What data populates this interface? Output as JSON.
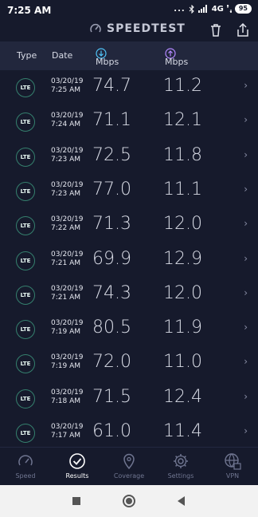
{
  "status": {
    "time": "7:25 AM",
    "dots": "...",
    "network": "4G",
    "battery": "95"
  },
  "app": {
    "title": "SPEEDTEST"
  },
  "header": {
    "type": "Type",
    "date": "Date",
    "download_unit": "Mbps",
    "upload_unit": "Mbps"
  },
  "results": [
    {
      "type": "LTE",
      "date": "03/20/19",
      "time": "7:25 AM",
      "download": "74.7",
      "upload": "11.2"
    },
    {
      "type": "LTE",
      "date": "03/20/19",
      "time": "7:24 AM",
      "download": "71.1",
      "upload": "12.1"
    },
    {
      "type": "LTE",
      "date": "03/20/19",
      "time": "7:23 AM",
      "download": "72.5",
      "upload": "11.8"
    },
    {
      "type": "LTE",
      "date": "03/20/19",
      "time": "7:23 AM",
      "download": "77.0",
      "upload": "11.1"
    },
    {
      "type": "LTE",
      "date": "03/20/19",
      "time": "7:22 AM",
      "download": "71.3",
      "upload": "12.0"
    },
    {
      "type": "LTE",
      "date": "03/20/19",
      "time": "7:21 AM",
      "download": "69.9",
      "upload": "12.9"
    },
    {
      "type": "LTE",
      "date": "03/20/19",
      "time": "7:21 AM",
      "download": "74.3",
      "upload": "12.0"
    },
    {
      "type": "LTE",
      "date": "03/20/19",
      "time": "7:19 AM",
      "download": "80.5",
      "upload": "11.9"
    },
    {
      "type": "LTE",
      "date": "03/20/19",
      "time": "7:19 AM",
      "download": "72.0",
      "upload": "11.0"
    },
    {
      "type": "LTE",
      "date": "03/20/19",
      "time": "7:18 AM",
      "download": "71.5",
      "upload": "12.4"
    },
    {
      "type": "LTE",
      "date": "03/20/19",
      "time": "7:17 AM",
      "download": "61.0",
      "upload": "11.4"
    }
  ],
  "tabs": [
    {
      "label": "Speed",
      "icon": "gauge-icon",
      "active": false
    },
    {
      "label": "Results",
      "icon": "check-circle-icon",
      "active": true
    },
    {
      "label": "Coverage",
      "icon": "map-pin-icon",
      "active": false
    },
    {
      "label": "Settings",
      "icon": "gear-icon",
      "active": false
    },
    {
      "label": "VPN",
      "icon": "globe-lock-icon",
      "active": false
    }
  ],
  "colors": {
    "background": "#161a2c",
    "header": "#22273d",
    "download_accent": "#4fc3f7",
    "upload_accent": "#b388ff",
    "badge_border": "#35806e"
  }
}
